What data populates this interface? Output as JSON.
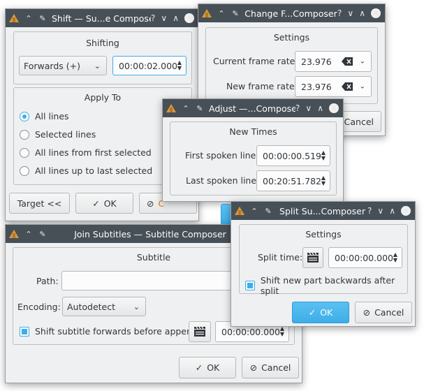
{
  "colors": {
    "titlebar": "#475057",
    "accent": "#3daee9",
    "window_bg": "#eff0f1"
  },
  "titlebar_buttons": {
    "help": "?",
    "minimize": "∨",
    "maximize": "∧",
    "close": "✕"
  },
  "shift": {
    "title": "Shift — Su...e Composer",
    "group_title": "Shifting",
    "direction": "Forwards (+)",
    "time": "00:00:02.000",
    "apply_title": "Apply To",
    "options": [
      "All lines",
      "Selected lines",
      "All lines from first selected",
      "All lines up to last selected"
    ],
    "target_btn": "Target <<",
    "ok_btn": "OK",
    "cancel_btn": "C"
  },
  "change": {
    "title": "Change F...Composer",
    "group_title": "Settings",
    "current_label": "Current frame rate:",
    "current_value": "23.976",
    "new_label": "New frame rate:",
    "new_value": "23.976",
    "cancel_btn": "Cancel"
  },
  "adjust": {
    "title": "Adjust —...Composer",
    "group_title": "New Times",
    "first_label": "First spoken line:",
    "first_value": "00:00:00.519",
    "last_label": "Last spoken line:",
    "last_value": "00:20:51.782"
  },
  "join": {
    "title": "Join Subtitles — Subtitle Composer",
    "group_title": "Subtitle",
    "path_label": "Path:",
    "path_value": "",
    "encoding_label": "Encoding:",
    "encoding_value": "Autodetect",
    "shift_label": "Shift subtitle forwards before append",
    "time": "00:00:00.000",
    "ok_btn": "OK",
    "cancel_btn": "Cancel"
  },
  "split": {
    "title": "Split Su...Composer",
    "group_title": "Settings",
    "time_label": "Split time:",
    "time_value": "00:00:00.000",
    "shift_label": "Shift new part backwards after split",
    "ok_btn": "OK",
    "cancel_btn": "Cancel"
  }
}
